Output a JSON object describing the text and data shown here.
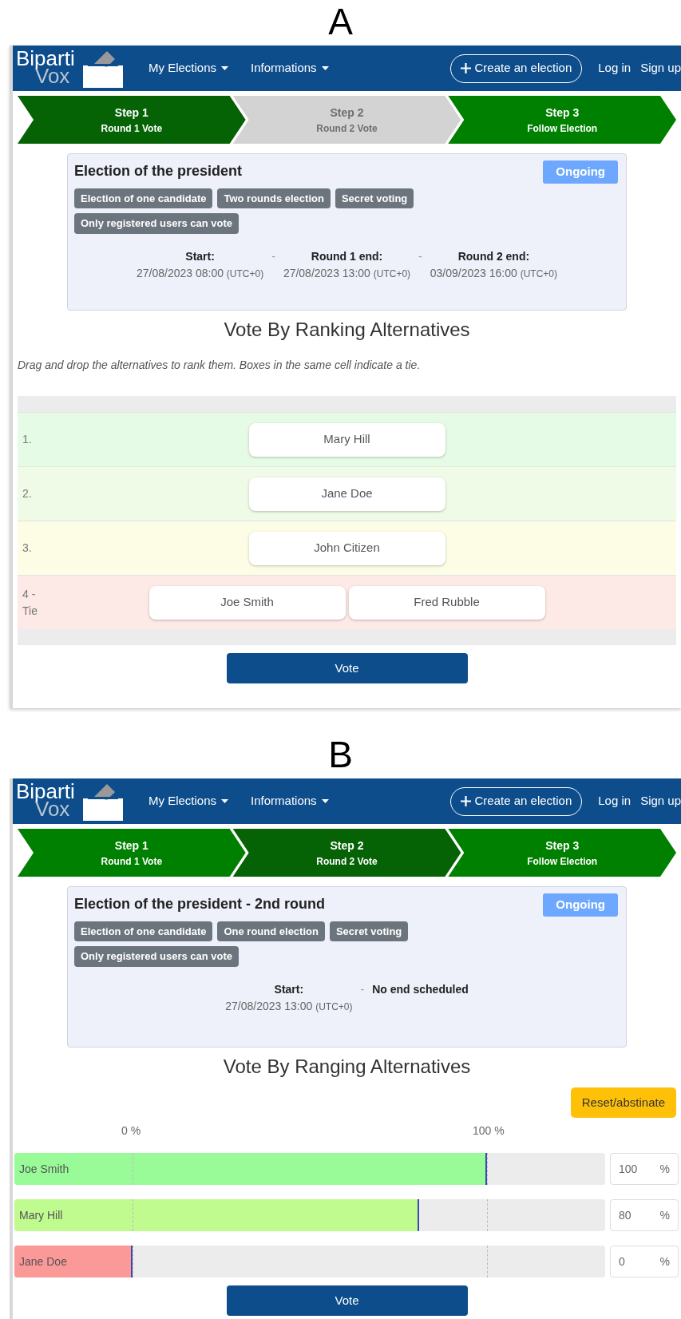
{
  "panels": [
    {
      "label": "A",
      "navbar": {
        "logo_top": "Biparti",
        "logo_bottom": "Vox",
        "menus": [
          "My Elections",
          "Informations"
        ],
        "create": "Create an election",
        "login": "Log in",
        "signup": "Sign up"
      },
      "steps": [
        {
          "title": "Step 1",
          "subtitle": "Round 1 Vote",
          "selected": true,
          "disabled": false
        },
        {
          "title": "Step 2",
          "subtitle": "Round 2 Vote",
          "selected": false,
          "disabled": true
        },
        {
          "title": "Step 3",
          "subtitle": "Follow Election",
          "selected": false,
          "disabled": false
        }
      ],
      "card": {
        "title": "Election of the president",
        "status": "Ongoing",
        "tags": [
          "Election of one candidate",
          "Two rounds election",
          "Secret voting",
          "Only registered users can vote"
        ],
        "separator": "-",
        "dates": [
          {
            "label": "Start:",
            "value": "27/08/2023 08:00",
            "tz": "(UTC+0)"
          },
          {
            "label": "Round 1 end:",
            "value": "27/08/2023 13:00",
            "tz": "(UTC+0)"
          },
          {
            "label": "Round 2 end:",
            "value": "03/09/2023 16:00",
            "tz": "(UTC+0)"
          }
        ]
      },
      "vote": {
        "kind": "ranking",
        "title": "Vote By Ranking Alternatives",
        "instruction": "Drag and drop the alternatives to rank them. Boxes in the same cell indicate a tie.",
        "rows": [
          {
            "rank": "1.",
            "color": "#e6fbe6",
            "items": [
              "Mary Hill"
            ]
          },
          {
            "rank": "2.",
            "color": "#effbe6",
            "items": [
              "Jane Doe"
            ]
          },
          {
            "rank": "3.",
            "color": "#fdfde6",
            "items": [
              "John Citizen"
            ]
          },
          {
            "rank": "4 - Tie",
            "color": "#fde9e6",
            "items": [
              "Joe Smith",
              "Fred Rubble"
            ]
          }
        ],
        "button": "Vote"
      }
    },
    {
      "label": "B",
      "navbar": {
        "logo_top": "Biparti",
        "logo_bottom": "Vox",
        "menus": [
          "My Elections",
          "Informations"
        ],
        "create": "Create an election",
        "login": "Log in",
        "signup": "Sign up"
      },
      "steps": [
        {
          "title": "Step 1",
          "subtitle": "Round 1 Vote",
          "selected": false,
          "disabled": false
        },
        {
          "title": "Step 2",
          "subtitle": "Round 2 Vote",
          "selected": true,
          "disabled": false
        },
        {
          "title": "Step 3",
          "subtitle": "Follow Election",
          "selected": false,
          "disabled": false
        }
      ],
      "card": {
        "title": "Election of the president - 2nd round",
        "status": "Ongoing",
        "tags": [
          "Election of one candidate",
          "One round election",
          "Secret voting",
          "Only registered users can vote"
        ],
        "separator": "-",
        "dates": [
          {
            "label": "Start:",
            "value": "27/08/2023 13:00",
            "tz": "(UTC+0)"
          },
          {
            "label": "No end scheduled"
          }
        ]
      },
      "vote": {
        "kind": "ranging",
        "title": "Vote By Ranging Alternatives",
        "reset": "Reset/abstinate",
        "min_label": "0 %",
        "max_label": "100 %",
        "rows": [
          {
            "name": "Joe Smith",
            "color": "#98fb98",
            "level": 0.8,
            "value": "100",
            "unit": "%"
          },
          {
            "name": "Mary Hill",
            "color": "#c0fb90",
            "level": 0.685,
            "value": "80",
            "unit": "%"
          },
          {
            "name": "Jane Doe",
            "color": "#fb9898",
            "level": 0.2,
            "value": "0",
            "unit": "%"
          }
        ],
        "button": "Vote"
      }
    }
  ]
}
